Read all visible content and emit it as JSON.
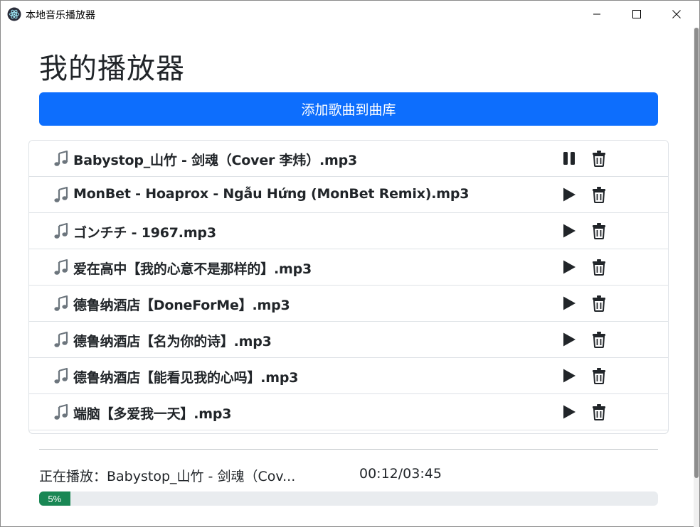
{
  "window": {
    "title": "本地音乐播放器"
  },
  "page": {
    "title": "我的播放器",
    "add_button_label": "添加歌曲到曲库"
  },
  "songs": [
    {
      "name": "Babystop_山竹 - 剑魂（Cover 李炜）.mp3",
      "state": "playing"
    },
    {
      "name": "MonBet - Hoaprox - Ngẫu Hứng (MonBet Remix).mp3",
      "state": "stopped"
    },
    {
      "name": "ゴンチチ - 1967.mp3",
      "state": "stopped"
    },
    {
      "name": "爱在高中【我的心意不是那样的】.mp3",
      "state": "stopped"
    },
    {
      "name": "德鲁纳酒店【DoneForMe】.mp3",
      "state": "stopped"
    },
    {
      "name": "德鲁纳酒店【名为你的诗】.mp3",
      "state": "stopped"
    },
    {
      "name": "德鲁纳酒店【能看见我的心吗】.mp3",
      "state": "stopped"
    },
    {
      "name": "端脑【多爱我一天】.mp3",
      "state": "stopped"
    }
  ],
  "player": {
    "now_playing": "正在播放：Babystop_山竹 - 剑魂（Cov...",
    "time": "00:12/03:45",
    "progress_percent": 5,
    "progress_label": "5%"
  },
  "colors": {
    "primary": "#0d6efd",
    "progress": "#198754",
    "text": "#212529",
    "icon_dark": "#212529",
    "icon_muted": "#6c757d"
  },
  "icons": {
    "song": "music-note-icon",
    "play": "play-icon",
    "pause": "pause-icon",
    "delete": "trash-icon"
  }
}
